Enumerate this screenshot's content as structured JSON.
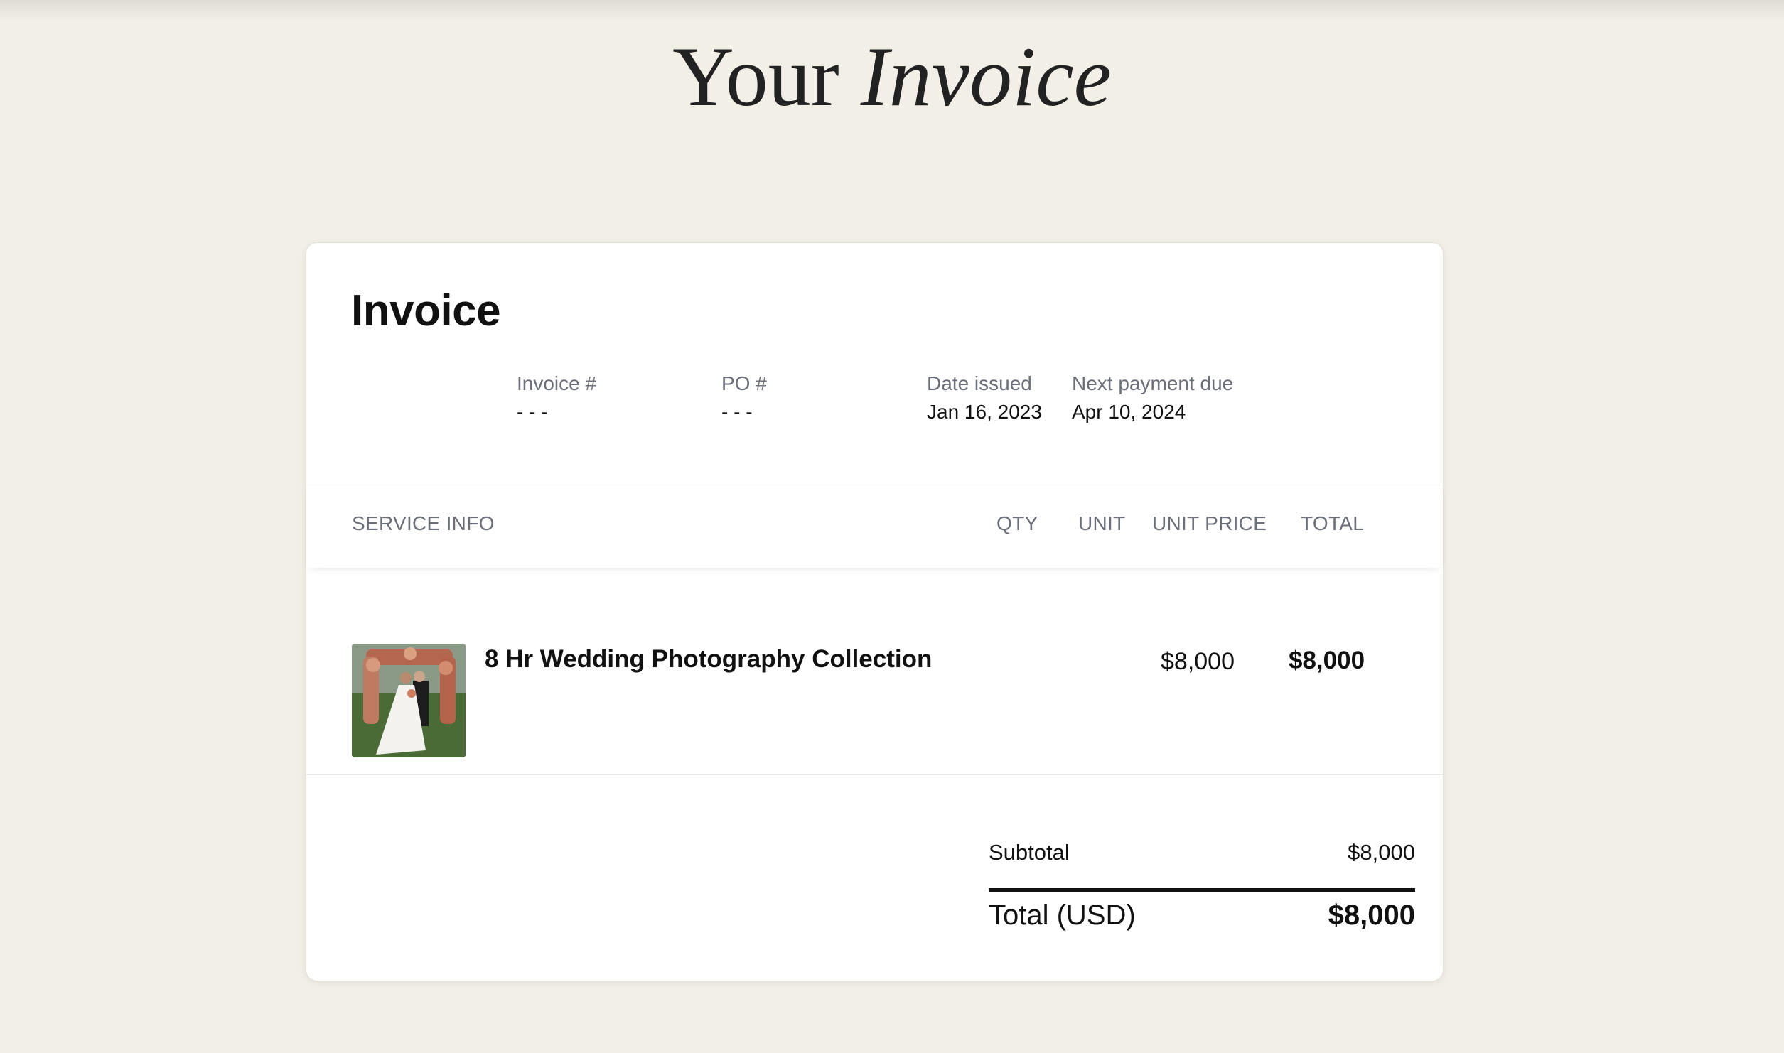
{
  "page": {
    "title_plain": "Your",
    "title_italic": "Invoice"
  },
  "invoice": {
    "heading": "Invoice",
    "meta": [
      {
        "label": "Invoice #",
        "value": "- - -"
      },
      {
        "label": "PO #",
        "value": "- - -"
      },
      {
        "label": "Date issued",
        "value": "Jan 16, 2023"
      },
      {
        "label": "Next payment due",
        "value": "Apr 10, 2024"
      }
    ],
    "columns": {
      "service_info": "SERVICE INFO",
      "qty": "QTY",
      "unit": "UNIT",
      "unit_price": "UNIT PRICE",
      "total": "TOTAL"
    },
    "items": [
      {
        "name": "8 Hr Wedding Photography Collection",
        "thumbnail_icon": "wedding-photo-thumbnail",
        "qty": "",
        "unit": "",
        "unit_price": "$8,000",
        "total": "$8,000"
      }
    ],
    "summary": {
      "subtotal_label": "Subtotal",
      "subtotal_value": "$8,000",
      "total_label": "Total (USD)",
      "total_value": "$8,000"
    }
  },
  "colors": {
    "background": "#f2efe7",
    "card": "#ffffff",
    "muted_text": "#6b6f7a",
    "text": "#111111"
  }
}
